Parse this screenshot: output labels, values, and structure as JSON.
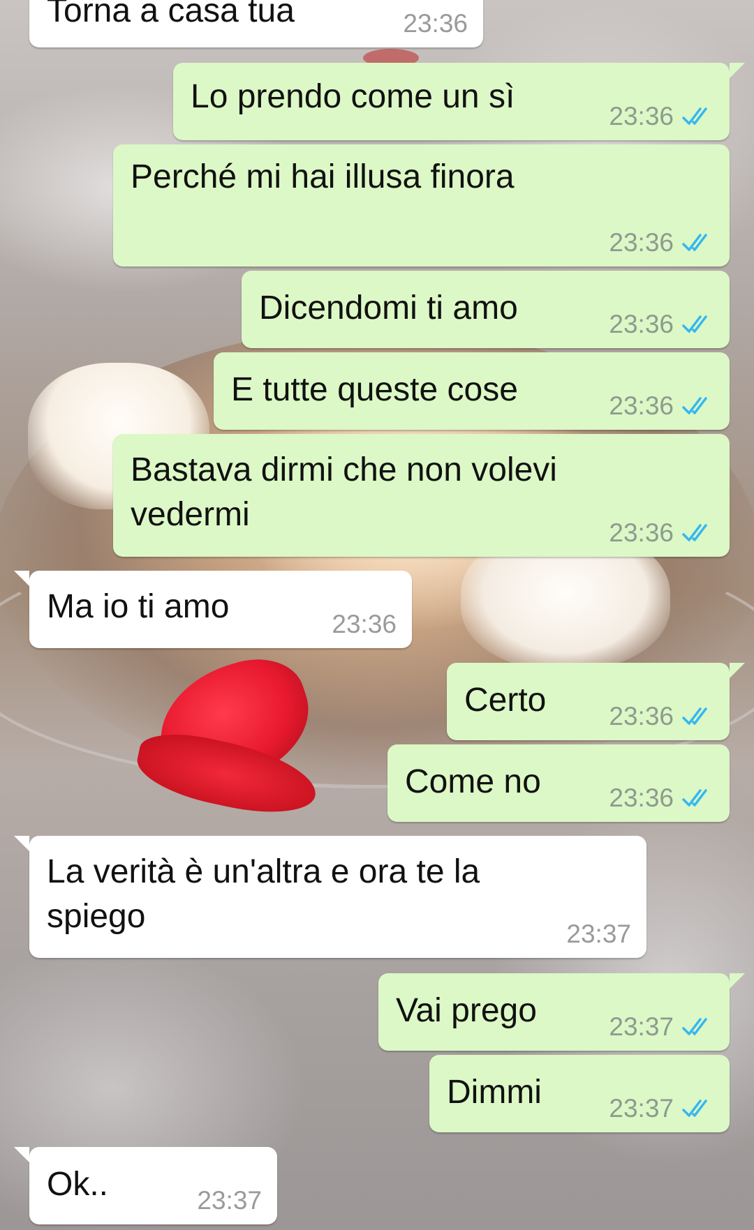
{
  "chat": {
    "messages": [
      {
        "direction": "in",
        "text": "Torna a casa tua",
        "time": "23:36"
      },
      {
        "direction": "out",
        "text": "Lo prendo come un sì",
        "time": "23:36",
        "status": "read"
      },
      {
        "direction": "out",
        "text": "Perché mi hai illusa finora",
        "time": "23:36",
        "status": "read"
      },
      {
        "direction": "out",
        "text": "Dicendomi ti amo",
        "time": "23:36",
        "status": "read"
      },
      {
        "direction": "out",
        "text": "E tutte queste cose",
        "time": "23:36",
        "status": "read"
      },
      {
        "direction": "out",
        "text": "Bastava dirmi che non volevi vedermi",
        "time": "23:36",
        "status": "read"
      },
      {
        "direction": "in",
        "text": "Ma io ti amo",
        "time": "23:36"
      },
      {
        "direction": "out",
        "text": "Certo",
        "time": "23:36",
        "status": "read"
      },
      {
        "direction": "out",
        "text": "Come no",
        "time": "23:36",
        "status": "read"
      },
      {
        "direction": "in",
        "text": "La verità è un'altra e ora te la spiego",
        "time": "23:37"
      },
      {
        "direction": "out",
        "text": "Vai prego",
        "time": "23:37",
        "status": "read"
      },
      {
        "direction": "out",
        "text": "Dimmi",
        "time": "23:37",
        "status": "read"
      },
      {
        "direction": "in",
        "text": "Ok..",
        "time": "23:37"
      }
    ]
  },
  "colors": {
    "outgoing_bubble": "#dcf8c6",
    "incoming_bubble": "#ffffff",
    "read_ticks": "#34b7f1"
  },
  "icons": {
    "read_receipt": "double-check-icon"
  }
}
